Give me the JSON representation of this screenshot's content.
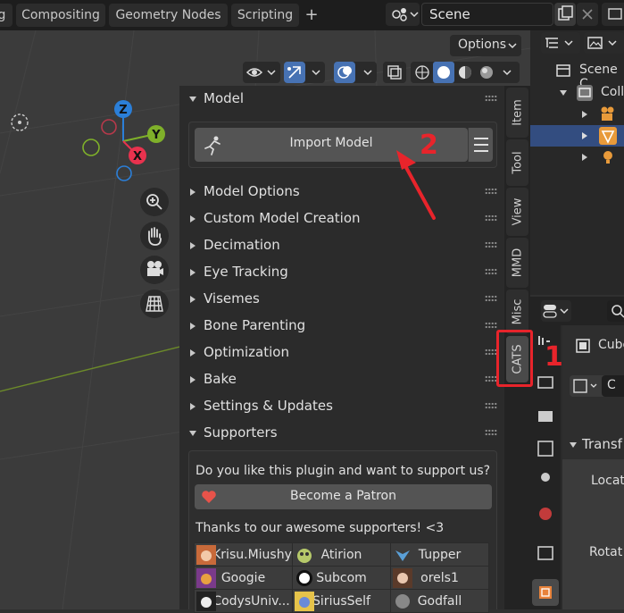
{
  "topbar": {
    "tabs": [
      "g",
      "Compositing",
      "Geometry Nodes",
      "Scripting"
    ],
    "add_tab_symbol": "+",
    "scene_name": "Scene"
  },
  "viewport": {
    "options_label": "Options",
    "gizmo_axes": [
      "Z",
      "Y",
      "X"
    ]
  },
  "npanel": {
    "model_header": "Model",
    "import_button": "Import Model",
    "sections": [
      "Model Options",
      "Custom Model Creation",
      "Decimation",
      "Eye Tracking",
      "Visemes",
      "Bone Parenting",
      "Optimization",
      "Bake",
      "Settings & Updates"
    ],
    "supporters_header": "Supporters",
    "support_question": "Do you like this plugin and want to support us?",
    "patron_button": "Become a Patron",
    "thanks_text": "Thanks to our awesome supporters! <3",
    "supporters": [
      [
        "Krisu.Miushy",
        "Atirion",
        "Tupper"
      ],
      [
        "Googie",
        "Subcom",
        "orels1"
      ],
      [
        "CodysUniv...",
        "SiriusSelf",
        "Godfall"
      ]
    ]
  },
  "sidetabs": [
    "Item",
    "Tool",
    "View",
    "MMD",
    "Misc",
    "CATS"
  ],
  "annotations": {
    "step1": "1",
    "step2": "2",
    "color": "#e8242b"
  },
  "outliner": {
    "scene_collection": "Scene C",
    "collection": "Colle"
  },
  "properties": {
    "object_name": "Cube",
    "data_name": "C",
    "transform_header": "Transf",
    "location_label": "Locat",
    "rotation_label": "Rotat"
  },
  "colors": {
    "accent_blue": "#4772b3",
    "x_axis": "#e8324e",
    "y_axis": "#7fb02a",
    "z_axis": "#2b7fd8"
  }
}
